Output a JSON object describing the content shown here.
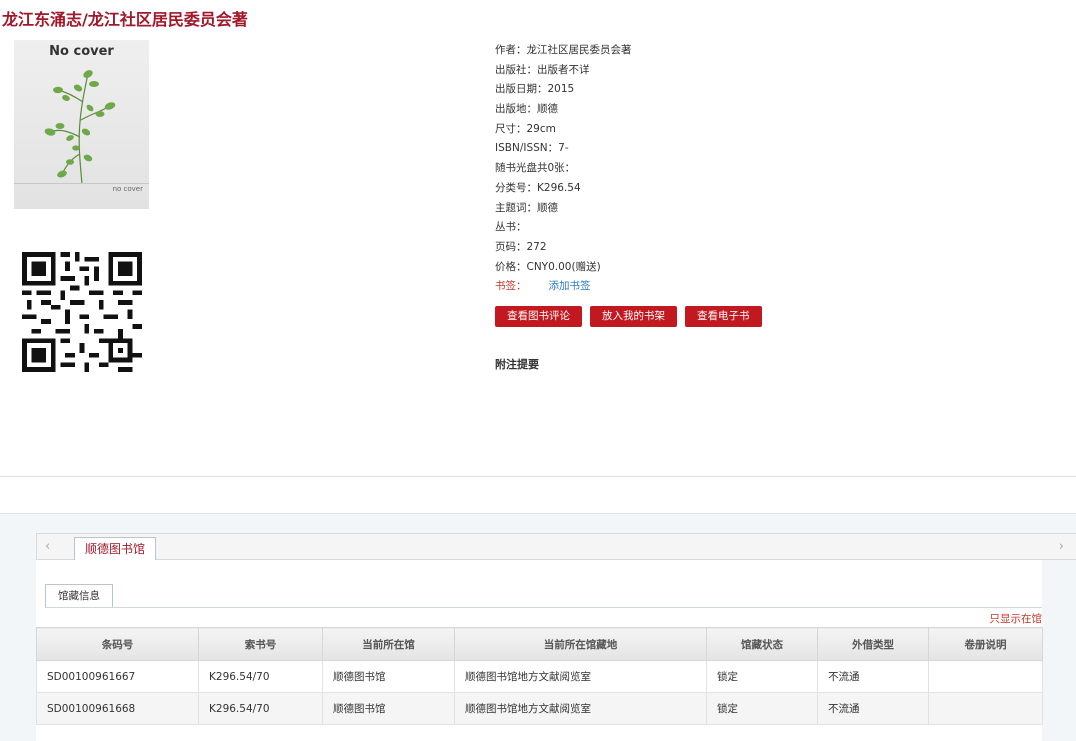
{
  "book": {
    "title": "龙江东涌志/龙江社区居民委员会著",
    "cover": {
      "text_large": "No cover",
      "text_small": "no cover"
    }
  },
  "meta": [
    {
      "label": "作者：",
      "value": "龙江社区居民委员会著"
    },
    {
      "label": "出版社：",
      "value": "出版者不详"
    },
    {
      "label": "出版日期：",
      "value": "2015"
    },
    {
      "label": "出版地：",
      "value": "顺德"
    },
    {
      "label": "尺寸：",
      "value": "29cm"
    },
    {
      "label": "ISBN/ISSN：",
      "value": "7-"
    },
    {
      "label": "随书光盘共0张：",
      "value": ""
    },
    {
      "label": "分类号：",
      "value": "K296.54"
    },
    {
      "label": "主题词：",
      "value": "顺德"
    },
    {
      "label": "丛书：",
      "value": ""
    },
    {
      "label": "页码：",
      "value": "272"
    },
    {
      "label": "价格：",
      "value": "CNY0.00(赠送)"
    }
  ],
  "bookmark": {
    "label": "书签：",
    "link": "添加书签"
  },
  "buttons": {
    "reviews": "查看图书评论",
    "shelf": "放入我的书架",
    "ebook": "查看电子书"
  },
  "note_title": "附注提要",
  "library_tab": {
    "left_arrow": "‹",
    "right_arrow": "›",
    "label": "顺德图书馆"
  },
  "holdings": {
    "subtab": "馆藏信息",
    "only_in": "只显示在馆",
    "headers": [
      "条码号",
      "索书号",
      "当前所在馆",
      "当前所在馆藏地",
      "馆藏状态",
      "外借类型",
      "卷册说明"
    ],
    "rows": [
      [
        "SD00100961667",
        "K296.54/70",
        "顺德图书馆",
        "顺德图书馆地方文献阅览室",
        "锁定",
        "不流通",
        ""
      ],
      [
        "SD00100961668",
        "K296.54/70",
        "顺德图书馆",
        "顺德图书馆地方文献阅览室",
        "锁定",
        "不流通",
        ""
      ]
    ]
  },
  "colors": {
    "accent": "#a0182a",
    "button": "#c2181f",
    "link": "#2c7ac0"
  }
}
